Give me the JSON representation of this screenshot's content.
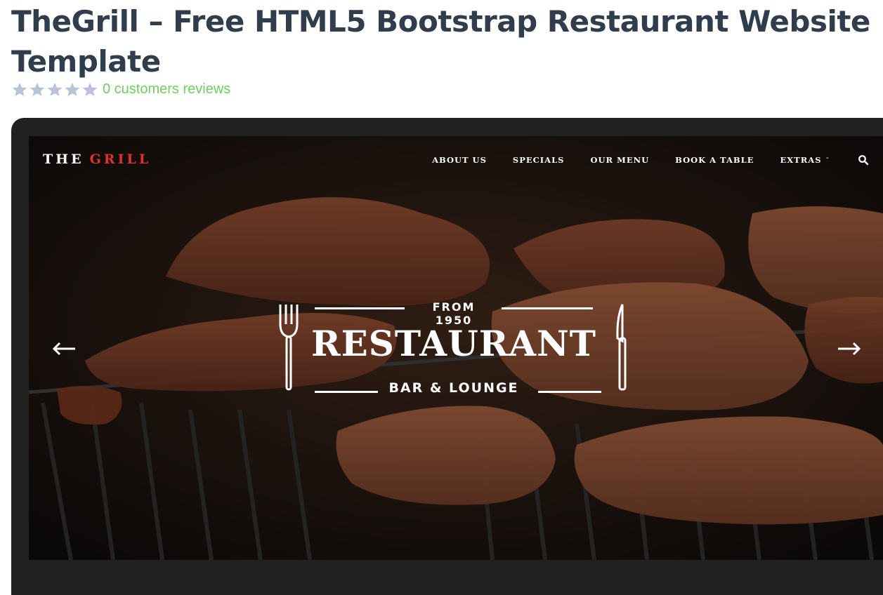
{
  "page": {
    "title": "TheGrill – Free HTML5 Bootstrap Restaurant Website Template",
    "rating_stars": 0,
    "reviews_text": "0 customers reviews"
  },
  "colors": {
    "title": "#2f3d4c",
    "reviews": "#6fcf62",
    "star": "#b9c3d6",
    "logo_accent": "#e0322a",
    "frame": "#212121"
  },
  "preview": {
    "logo_part1": "THE",
    "logo_part2": "GRILL",
    "nav": [
      "ABOUT US",
      "SPECIALS",
      "OUR MENU",
      "BOOK A TABLE",
      "EXTRAS"
    ],
    "nav_dropdown_caret": "ˇ",
    "search_icon": "search-icon",
    "hero": {
      "since": "FROM 1950",
      "brand": "RESTAURANT",
      "tagline": "BAR & LOUNGE"
    },
    "prev_arrow": "arrow-left-icon",
    "next_arrow": "arrow-right-icon"
  }
}
